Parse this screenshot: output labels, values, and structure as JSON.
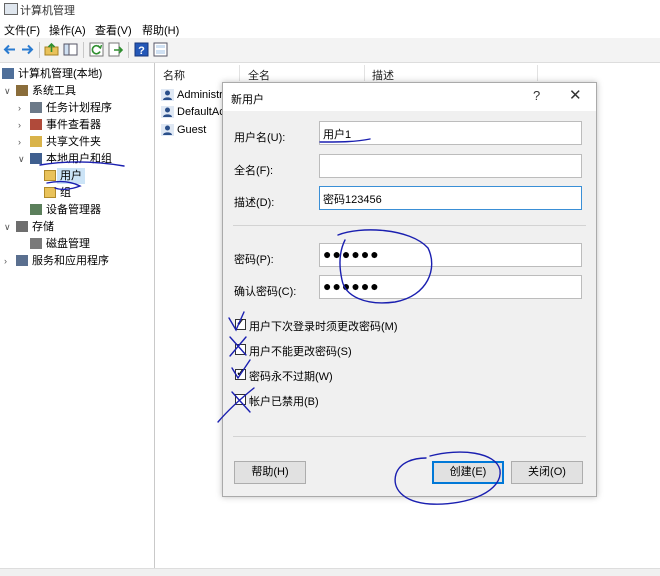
{
  "window": {
    "title": "计算机管理",
    "icon": "computer-management-icon"
  },
  "menu": [
    "文件(F)",
    "操作(A)",
    "查看(V)",
    "帮助(H)"
  ],
  "toolbar": {
    "icons": [
      "back-arrow-icon",
      "forward-arrow-icon",
      "up-folder-icon",
      "show-hide-tree-icon",
      "refresh-icon",
      "export-icon",
      "help-icon",
      "properties-icon"
    ]
  },
  "tree": [
    {
      "label": "计算机管理(本地)",
      "level": 0,
      "expander": "",
      "icon": "computer-icon"
    },
    {
      "label": "系统工具",
      "level": 1,
      "expander": "v",
      "icon": "tools-icon"
    },
    {
      "label": "任务计划程序",
      "level": 2,
      "expander": ">",
      "icon": "clock-icon"
    },
    {
      "label": "事件查看器",
      "level": 2,
      "expander": ">",
      "icon": "event-viewer-icon"
    },
    {
      "label": "共享文件夹",
      "level": 2,
      "expander": ">",
      "icon": "shared-folder-icon"
    },
    {
      "label": "本地用户和组",
      "level": 2,
      "expander": "v",
      "icon": "users-group-icon"
    },
    {
      "label": "用户",
      "level": 3,
      "expander": "",
      "icon": "folder-icon",
      "selected": true
    },
    {
      "label": "组",
      "level": 3,
      "expander": "",
      "icon": "folder-icon"
    },
    {
      "label": "设备管理器",
      "level": 2,
      "expander": "",
      "icon": "device-manager-icon"
    },
    {
      "label": "存储",
      "level": 1,
      "expander": "v",
      "icon": "storage-icon"
    },
    {
      "label": "磁盘管理",
      "level": 2,
      "expander": "",
      "icon": "disk-icon"
    },
    {
      "label": "服务和应用程序",
      "level": 1,
      "expander": ">",
      "icon": "services-icon"
    }
  ],
  "list": {
    "columns": [
      "名称",
      "全名",
      "描述"
    ],
    "rows": [
      "Administrator",
      "DefaultAccount",
      "Guest"
    ]
  },
  "dialog": {
    "title": "新用户",
    "help_glyph": "?",
    "close_glyph": "✕",
    "username_label": "用户名(U):",
    "username_value": "用户1",
    "fullname_label": "全名(F):",
    "fullname_value": "",
    "description_label": "描述(D):",
    "description_value": "密码123456",
    "password_label": "密码(P):",
    "password_value": "●●●●●●",
    "confirm_label": "确认密码(C):",
    "confirm_value": "●●●●●●",
    "checkboxes": [
      {
        "label": "用户下次登录时须更改密码(M)",
        "checked": true
      },
      {
        "label": "用户不能更改密码(S)",
        "checked": false
      },
      {
        "label": "密码永不过期(W)",
        "checked": true
      },
      {
        "label": "帐户已禁用(B)",
        "checked": false
      }
    ],
    "help_button": "帮助(H)",
    "create_button": "创建(E)",
    "close_button": "关闭(O)"
  },
  "colors": {
    "selection": "#cce4f7",
    "focus_border": "#3a8fd6",
    "annotation_ink": "#1a1fb0"
  }
}
